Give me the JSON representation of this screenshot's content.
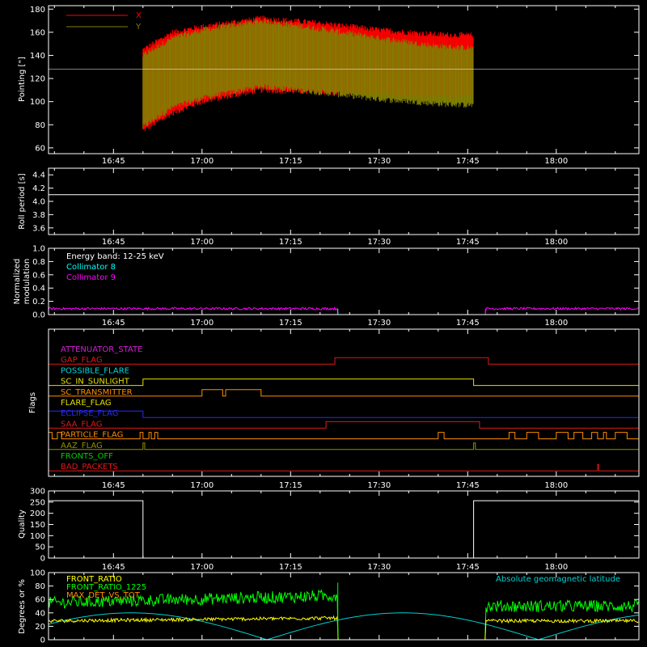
{
  "time_axis": {
    "tick_labels": [
      "16:45",
      "17:00",
      "17:15",
      "17:30",
      "17:45",
      "18:00"
    ],
    "tick_minutes": [
      1005,
      1020,
      1035,
      1050,
      1065,
      1080
    ],
    "range_minutes": [
      994,
      1094
    ],
    "minor_step_minutes": 5
  },
  "panels": {
    "pointing": {
      "ylabel": "Pointing [\"]",
      "ylim": [
        55,
        183
      ],
      "ticks": [
        60,
        80,
        100,
        120,
        140,
        160,
        180
      ],
      "legend": [
        "X",
        "Y"
      ],
      "reference_line": 128,
      "data_start": 1010,
      "data_end": 1066
    },
    "roll": {
      "ylabel": "Roll period [s]",
      "ylim": [
        3.5,
        4.5
      ],
      "ticks": [
        3.6,
        3.8,
        4.0,
        4.2,
        4.4
      ],
      "tick_labels": [
        "3.6",
        "3.8",
        "4.0",
        "4.2",
        "4.4"
      ],
      "value": 4.1
    },
    "modulation": {
      "ylabel_line1": "Normalized",
      "ylabel_line2": "modulation",
      "ylim": [
        0,
        1
      ],
      "ticks": [
        0,
        0.2,
        0.4,
        0.6,
        0.8,
        1.0
      ],
      "tick_labels": [
        "0.0",
        "0.2",
        "0.4",
        "0.6",
        "0.8",
        "1.0"
      ],
      "legend_energy": "Energy band: 12-25 keV",
      "legend_c8": "Collimator 8",
      "legend_c9": "Collimator 9",
      "gap_start": 1043,
      "gap_end": 1068,
      "level": 0.09
    },
    "flags": {
      "ylabel": "Flags",
      "items": [
        {
          "name": "ATTENUATOR_STATE",
          "color": "#d020d0"
        },
        {
          "name": "GAP_FLAG",
          "color": "#e01818"
        },
        {
          "name": "POSSIBLE_FLARE",
          "color": "#00d8d8"
        },
        {
          "name": "SC_IN_SUNLIGHT",
          "color": "#e0e000"
        },
        {
          "name": "SC_TRANSMITTER",
          "color": "#ff8c00"
        },
        {
          "name": "FLARE_FLAG",
          "color": "#e0e000"
        },
        {
          "name": "ECLIPSE_FLAG",
          "color": "#2828ff"
        },
        {
          "name": "SAA_FLAG",
          "color": "#e01818"
        },
        {
          "name": "PARTICLE_FLAG",
          "color": "#ff8c00"
        },
        {
          "name": "AAZ_FLAG",
          "color": "#909000"
        },
        {
          "name": "FRONTS_OFF",
          "color": "#00d000"
        },
        {
          "name": "BAD_PACKETS",
          "color": "#e01818"
        }
      ]
    },
    "quality": {
      "ylabel": "Quality",
      "ylim": [
        0,
        300
      ],
      "ticks": [
        0,
        50,
        100,
        150,
        200,
        250,
        300
      ],
      "high_value": 256,
      "low_start": 1010,
      "low_end": 1066
    },
    "ratios": {
      "ylabel": "Degrees or %",
      "ylim": [
        0,
        100
      ],
      "ticks": [
        0,
        20,
        40,
        60,
        80,
        100
      ],
      "legend_front_ratio": "FRONT_RATIO",
      "legend_front_ratio_1225": "FRONT_RATIO_1225",
      "legend_max_det": "MAX_DET_VS_TOT",
      "legend_geomag": "Absolute geomagnetic latitude",
      "gap_start": 1043,
      "gap_end": 1068
    }
  },
  "colors": {
    "x_series": "#ff0000",
    "y_series": "#808000",
    "collimator8": "#00ffff",
    "collimator9": "#ff00ff",
    "front_ratio": "#ffff00",
    "front_ratio_1225": "#00ff00",
    "max_det": "#ff8c00",
    "geomag": "#00d0d0",
    "axes": "#ffffff"
  },
  "chart_data": [
    {
      "type": "area",
      "ylabel": "Pointing [\"]",
      "ylim": [
        55,
        183
      ],
      "series": [
        {
          "name": "X",
          "x": [
            "16:50",
            "16:55",
            "17:00",
            "17:10",
            "17:20",
            "17:30",
            "17:40",
            "17:50"
          ],
          "min": [
            75,
            90,
            100,
            110,
            108,
            106,
            104,
            104
          ],
          "max": [
            145,
            160,
            165,
            172,
            168,
            162,
            158,
            157
          ]
        },
        {
          "name": "Y",
          "x": [
            "16:50",
            "16:55",
            "17:00",
            "17:10",
            "17:20",
            "17:30",
            "17:40",
            "17:50"
          ],
          "min": [
            78,
            95,
            103,
            113,
            108,
            102,
            98,
            96
          ],
          "max": [
            140,
            155,
            162,
            170,
            163,
            155,
            148,
            145
          ]
        }
      ]
    },
    {
      "type": "line",
      "ylabel": "Roll period [s]",
      "series": [
        {
          "x": [
            "16:40",
            "18:10"
          ],
          "values": [
            4.1,
            4.1
          ]
        }
      ]
    },
    {
      "type": "line",
      "ylabel": "Normalized modulation",
      "series": [
        {
          "name": "Collimator 9",
          "x": [
            "16:40",
            "17:28",
            "17:53",
            "18:10"
          ],
          "values": [
            0.09,
            0.09,
            0.09,
            0.09
          ]
        }
      ]
    },
    {
      "type": "line",
      "ylabel": "Quality",
      "series": [
        {
          "x": [
            "16:40",
            "16:50",
            "16:50",
            "17:46",
            "17:46",
            "18:10"
          ],
          "values": [
            256,
            256,
            0,
            0,
            256,
            256
          ]
        }
      ]
    },
    {
      "type": "line",
      "ylabel": "Degrees or %",
      "series": [
        {
          "name": "FRONT_RATIO",
          "x": [
            "16:40",
            "17:00",
            "17:20",
            "17:28",
            "17:53",
            "18:10"
          ],
          "values": [
            28,
            28,
            30,
            33,
            27,
            28
          ]
        },
        {
          "name": "FRONT_RATIO_1225",
          "x": [
            "16:40",
            "17:00",
            "17:20",
            "17:28",
            "17:53",
            "18:10"
          ],
          "values": [
            55,
            62,
            65,
            68,
            52,
            50
          ]
        },
        {
          "name": "Absolute geomagnetic latitude",
          "x": [
            "16:46",
            "17:08",
            "17:31",
            "17:47",
            "18:10"
          ],
          "values": [
            0,
            40,
            0,
            40,
            0
          ]
        }
      ]
    }
  ]
}
